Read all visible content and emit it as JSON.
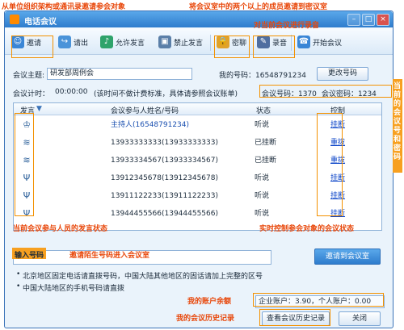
{
  "annotations": {
    "top_left": "从单位组织架构或通讯录邀请参会对象",
    "top_center": "将会议室中的两个以上的成员邀请到密议室",
    "record": "对当前会议进行录音",
    "right_vertical": "当前的会议号和密码",
    "bottom_left": "当前会议参与人员的发言状态",
    "bottom_right": "实时控制参会对象的会议状态",
    "input_hint": "输入号码",
    "input_note": "邀请陌生号码进入会议室",
    "balance": "我的账户余额",
    "history": "我的会议历史记录"
  },
  "window": {
    "title": "电话会议"
  },
  "toolbar": {
    "invite": "邀请",
    "remove": "请出",
    "allow_speak": "允许发言",
    "mute": "禁止发言",
    "private": "密聊",
    "record": "录音",
    "start": "开始会议"
  },
  "meeting": {
    "topic_label": "会议主题:",
    "topic_value": "研发部周例会",
    "my_number_label": "我的号码：16548791234",
    "change_number": "更改号码",
    "time_label": "会议计时：",
    "time_value": "00:00:00",
    "time_note": "(该时间不做计费标准，具体请参照会议账单)",
    "room_number": "会议号码：1370",
    "room_password": "会议密码：1234"
  },
  "table": {
    "headers": {
      "speak": "发言",
      "name": "会议参与人姓名/号码",
      "status": "状态",
      "control": "控制"
    },
    "rows": [
      {
        "name": "主持人(16548791234)",
        "status": "听说",
        "control": "挂断",
        "name_color": "#1a4fb0"
      },
      {
        "name": "13933333333(13933333333)",
        "status": "已挂断",
        "control": "重拨",
        "name_color": "#1a2a3a"
      },
      {
        "name": "13933334567(13933334567)",
        "status": "已挂断",
        "control": "重拨",
        "name_color": "#1a2a3a"
      },
      {
        "name": "13912345678(13912345678)",
        "status": "听说",
        "control": "挂断",
        "name_color": "#1a2a3a"
      },
      {
        "name": "13911122233(13911122233)",
        "status": "听说",
        "control": "挂断",
        "name_color": "#1a2a3a"
      },
      {
        "name": "13944455566(13944455566)",
        "status": "听说",
        "control": "挂断",
        "name_color": "#1a2a3a"
      }
    ]
  },
  "invite": {
    "button": "邀请到会议室"
  },
  "notes": {
    "line1": "北京地区固定电话请直拨号码，中国大陆其他地区的固话请加上完整的区号",
    "line2": "中国大陆地区的手机号码请直拨"
  },
  "account": {
    "text": "企业账户：3.90，个人账户：0.00"
  },
  "footer": {
    "history_button": "查看会议历史记录",
    "close_button": "关闭"
  }
}
